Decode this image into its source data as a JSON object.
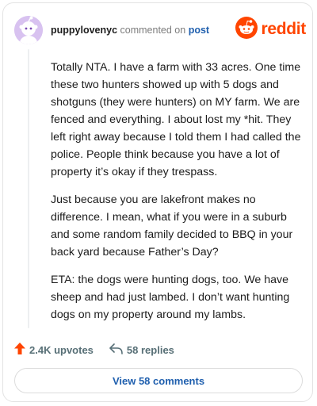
{
  "header": {
    "username": "puppylovenyc",
    "action_text": "commented on",
    "post_link": "post",
    "brand_name": "reddit"
  },
  "comment": {
    "paragraphs": [
      "Totally NTA. I have a farm with 33 acres. One time these two hunters showed up with 5 dogs and shotguns (they were hunters) on MY farm. We are fenced and everything. I about lost my *hit. They left right away because I told them I had called the police. People think because you have a lot of property it’s okay if they trespass.",
      "Just because you are lakefront makes no difference. I mean, what if you were in a suburb and some random family decided to BBQ in your back yard because Father’s Day?",
      "ETA: the dogs were hunting dogs, too. We have sheep and had just lambed. I don’t want hunting dogs on my property around my lambs."
    ]
  },
  "actions": {
    "upvotes_label": "2.4K upvotes",
    "replies_label": "58 replies",
    "view_comments_label": "View 58 comments"
  },
  "colors": {
    "brand": "#ff4500",
    "link": "#1f5fae",
    "avatar_bg": "#d8c2f0"
  },
  "icons": {
    "avatar": "snoo-avatar-icon",
    "brand_logo": "reddit-logo-icon",
    "upvote": "upvote-arrow-icon",
    "reply": "reply-arrow-icon"
  }
}
